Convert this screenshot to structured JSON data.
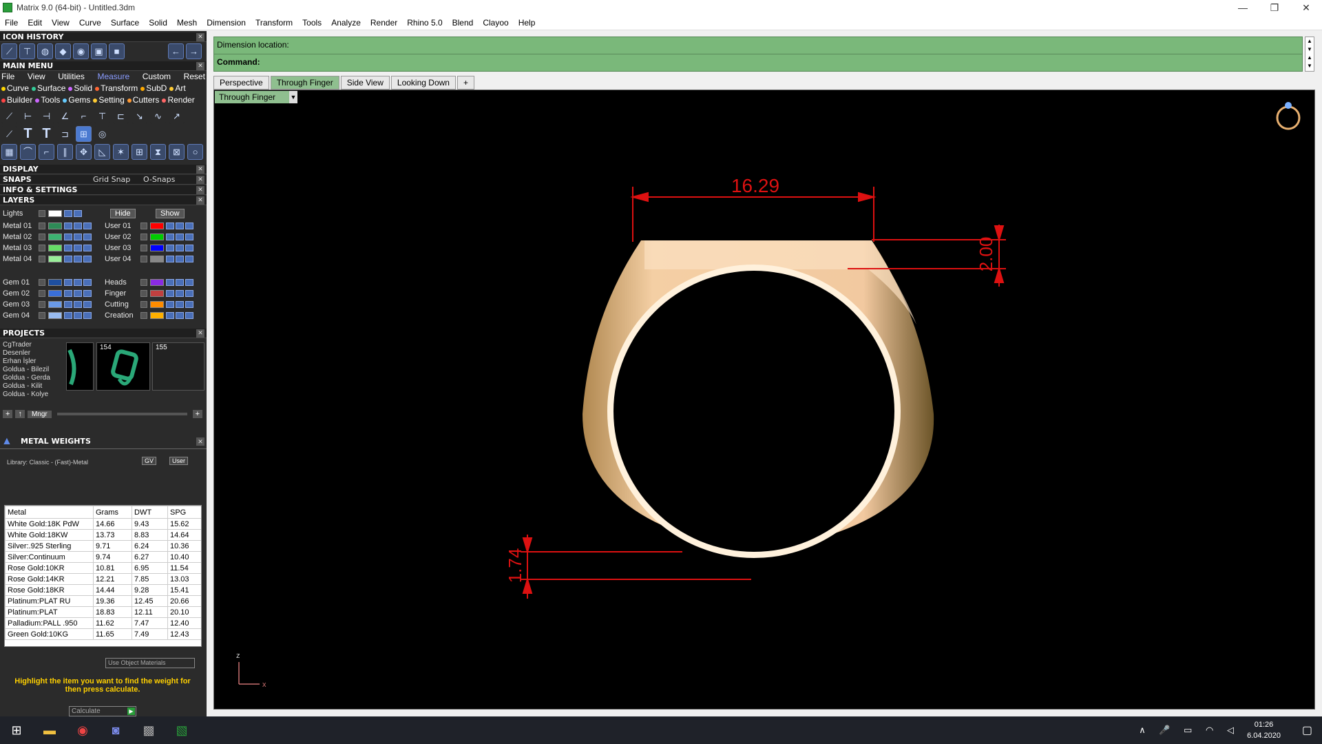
{
  "window": {
    "title": "Matrix 9.0 (64-bit) - Untitled.3dm"
  },
  "menu": [
    "File",
    "Edit",
    "View",
    "Curve",
    "Surface",
    "Solid",
    "Mesh",
    "Dimension",
    "Transform",
    "Tools",
    "Analyze",
    "Render",
    "Rhino 5.0",
    "Blend",
    "Clayoo",
    "Help"
  ],
  "sections": {
    "icon_history": "ICON HISTORY",
    "main_menu": "MAIN MENU",
    "display": "DISPLAY",
    "snaps": "SNAPS",
    "info": "INFO & SETTINGS",
    "layers": "LAYERS",
    "projects": "PROJECTS",
    "metal_weights": "METAL WEIGHTS"
  },
  "main_menu_tabs": [
    "File",
    "View",
    "Utilities",
    "Measure",
    "Custom",
    "Reset"
  ],
  "main_menu_row1": [
    "Curve",
    "Surface",
    "Solid",
    "Transform",
    "SubD",
    "Art"
  ],
  "main_menu_row2": [
    "Builder",
    "Tools",
    "Gems",
    "Setting",
    "Cutters",
    "Render"
  ],
  "snaps": {
    "grid": "Grid Snap",
    "osnaps": "O-Snaps"
  },
  "layers": {
    "lights": "Lights",
    "hide": "Hide",
    "show": "Show",
    "left": [
      {
        "name": "Metal 01",
        "color": "#2e8b57"
      },
      {
        "name": "Metal 02",
        "color": "#3cb371"
      },
      {
        "name": "Metal 03",
        "color": "#66dd66"
      },
      {
        "name": "Metal 04",
        "color": "#99ee99"
      },
      {
        "name": "Gem 01",
        "color": "#1e4fa0"
      },
      {
        "name": "Gem 02",
        "color": "#3a6fd8"
      },
      {
        "name": "Gem 03",
        "color": "#6a9ae8"
      },
      {
        "name": "Gem 04",
        "color": "#9abcf0"
      }
    ],
    "right": [
      {
        "name": "User 01",
        "color": "#ff0000"
      },
      {
        "name": "User 02",
        "color": "#00cc00"
      },
      {
        "name": "User 03",
        "color": "#0000ff"
      },
      {
        "name": "User 04",
        "color": "#888888"
      },
      {
        "name": "Heads",
        "color": "#8a2be2"
      },
      {
        "name": "Finger",
        "color": "#c04040"
      },
      {
        "name": "Cutting",
        "color": "#ff8c00"
      },
      {
        "name": "Creation",
        "color": "#ffb000"
      }
    ]
  },
  "projects": {
    "list": [
      "CgTrader",
      "Desenler",
      "Erhan İşler",
      "Goldua - Bilezil",
      "Goldua - Gerda",
      "Goldua - Kilit",
      "Goldua - Kolye"
    ],
    "thumbs": [
      "154",
      "155"
    ],
    "mngr": "Mngr"
  },
  "metal_weights": {
    "library": "Library: Classic - (Fast)-Metal",
    "gv": "GV",
    "user": "User",
    "columns": [
      "Metal",
      "Grams",
      "DWT",
      "SPG"
    ],
    "rows": [
      [
        "White Gold:18K PdW",
        "14.66",
        "9.43",
        "15.62"
      ],
      [
        "White Gold:18KW",
        "13.73",
        "8.83",
        "14.64"
      ],
      [
        "Silver:.925 Sterling",
        "9.71",
        "6.24",
        "10.36"
      ],
      [
        "Silver:Continuum",
        "9.74",
        "6.27",
        "10.40"
      ],
      [
        "Rose Gold:10KR",
        "10.81",
        "6.95",
        "11.54"
      ],
      [
        "Rose Gold:14KR",
        "12.21",
        "7.85",
        "13.03"
      ],
      [
        "Rose Gold:18KR",
        "14.44",
        "9.28",
        "15.41"
      ],
      [
        "Platinum:PLAT RU",
        "19.36",
        "12.45",
        "20.66"
      ],
      [
        "Platinum:PLAT",
        "18.83",
        "12.11",
        "20.10"
      ],
      [
        "Palladium:PALL .950",
        "11.62",
        "7.47",
        "12.40"
      ],
      [
        "Green Gold:10KG",
        "11.65",
        "7.49",
        "12.43"
      ]
    ],
    "use_object": "Use Object Materials",
    "hint": "Highlight the item you want to find the weight for then press calculate.",
    "calculate": "Calculate"
  },
  "command": {
    "dimension": "Dimension location:",
    "command": "Command:"
  },
  "tabs": [
    "Perspective",
    "Through Finger",
    "Side View",
    "Looking Down"
  ],
  "viewport_label": "Through Finger",
  "dimensions": {
    "width": "16.29",
    "top": "2.00",
    "bottom": "1.74"
  },
  "axis": {
    "z": "z",
    "x": "x"
  },
  "clock": {
    "time": "01:26",
    "date": "6.04.2020"
  },
  "colors": {
    "accent_green": "#8fbf8f",
    "dim_red": "#dd1111",
    "ring_gold": "#f2c9a0"
  }
}
